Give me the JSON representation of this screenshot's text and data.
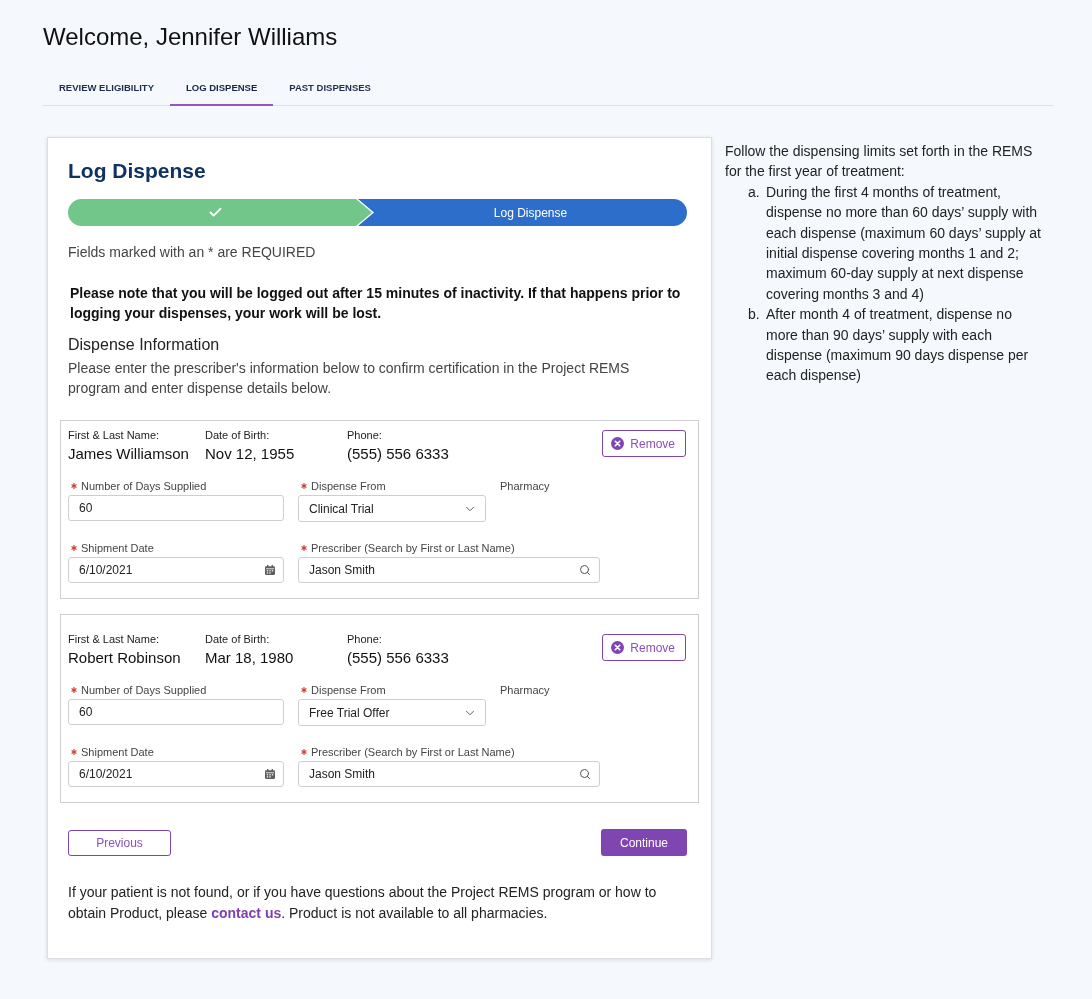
{
  "header": {
    "title": "Welcome, Jennifer Williams"
  },
  "tabs": [
    {
      "label": "REVIEW ELIGIBILITY",
      "selected": false
    },
    {
      "label": "LOG DISPENSE",
      "selected": true
    },
    {
      "label": "PAST DISPENSES",
      "selected": false
    }
  ],
  "form": {
    "title": "Log Dispense",
    "stepper": {
      "steps": [
        {
          "done": true
        },
        {
          "done": false,
          "label": "Log Dispense"
        }
      ]
    },
    "required_note": "Fields marked with an * are REQUIRED",
    "notice": "Please note that you will be logged out after 15 minutes of inactivity. If that happens prior to logging your dispenses, your work will be lost.",
    "section_title": "Dispense Information",
    "section_intro": "Please enter the prescriber's information below to confirm certification in the Project REMS program and enter dispense details below.",
    "patients": [
      {
        "info": [
          {
            "label": "First & Last Name:",
            "value": "James Williamson"
          },
          {
            "label": "Date of Birth:",
            "value": "Nov 12, 1955"
          },
          {
            "label": "Phone:",
            "value": "(555) 556 6333"
          }
        ],
        "remove_button": "Remove",
        "field_rows": [
          [
            {
              "kind": "text",
              "label": "Number of Days Supplied",
              "required": true,
              "value": "60"
            },
            {
              "kind": "select",
              "label": "Dispense From",
              "required": true,
              "value": "Clinical Trial"
            },
            {
              "kind": "label",
              "label": "Pharmacy",
              "required": false
            }
          ],
          [
            {
              "kind": "date",
              "label": "Shipment Date",
              "required": true,
              "value": "6/10/2021"
            },
            {
              "kind": "search",
              "label": "Prescriber (Search by First or Last Name)",
              "required": true,
              "value": "Jason Smith"
            }
          ]
        ]
      },
      {
        "info": [
          {
            "label": "First & Last Name:",
            "value": "Robert Robinson"
          },
          {
            "label": "Date of Birth:",
            "value": "Mar 18, 1980"
          },
          {
            "label": "Phone:",
            "value": "(555) 556 6333"
          }
        ],
        "remove_button": "Remove",
        "field_rows": [
          [
            {
              "kind": "text",
              "label": "Number of Days Supplied",
              "required": true,
              "value": "60"
            },
            {
              "kind": "select",
              "label": "Dispense From",
              "required": true,
              "value": "Free Trial Offer"
            },
            {
              "kind": "label",
              "label": "Pharmacy",
              "required": false
            }
          ],
          [
            {
              "kind": "date",
              "label": "Shipment Date",
              "required": true,
              "value": "6/10/2021"
            },
            {
              "kind": "search",
              "label": "Prescriber (Search by First or Last Name)",
              "required": true,
              "value": "Jason Smith"
            }
          ]
        ]
      }
    ],
    "buttons": {
      "previous": "Previous",
      "continue": "Continue"
    },
    "help": {
      "before": "If your patient is not found, or if you have questions about the Project REMS program or how to obtain Product, please ",
      "link": "contact us",
      "after": ". Product is not available to all pharmacies."
    }
  },
  "guidance": {
    "intro": "Follow the dispensing limits set forth in the REMS for the first year of treatment:",
    "items": [
      {
        "marker": "a.",
        "text": "During the first 4 months of treatment, dispense no more than 60 days’ supply with each dispense (maximum 60 days’ supply at initial dispense covering months 1 and 2; maximum 60-day supply at next dispense covering months 3 and 4)"
      },
      {
        "marker": "b.",
        "text": "After month 4 of treatment, dispense no more than 90 days’ supply with each dispense (maximum 90 days dispense per each dispense)"
      }
    ]
  }
}
